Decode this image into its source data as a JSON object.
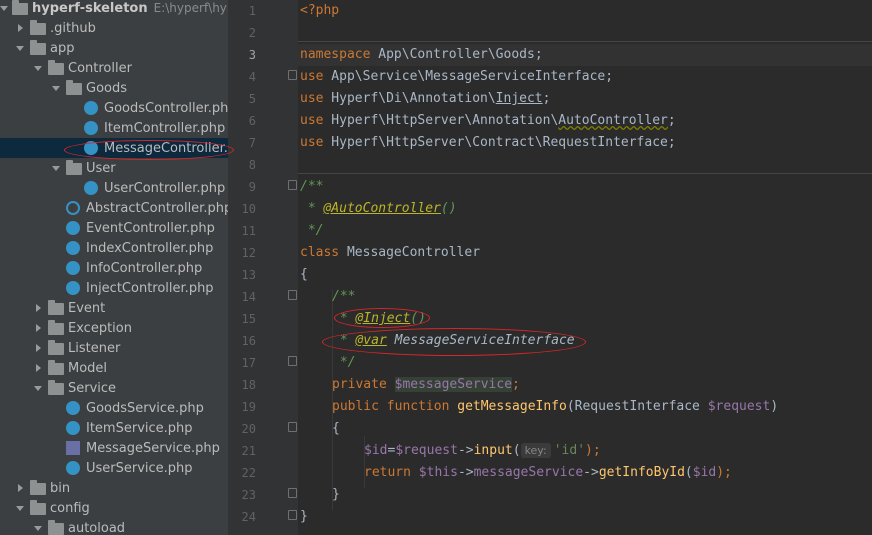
{
  "tree": {
    "root": {
      "label": "hyperf-skeleton",
      "path": "E:\\hyperf\\hyperf-s"
    },
    "items": [
      {
        "label": ".github",
        "kind": "folder",
        "arrow": "right",
        "indent": 0
      },
      {
        "label": "app",
        "kind": "folder",
        "arrow": "down",
        "indent": 0
      },
      {
        "label": "Controller",
        "kind": "folder",
        "arrow": "down",
        "indent": 1
      },
      {
        "label": "Goods",
        "kind": "folder",
        "arrow": "down",
        "indent": 2
      },
      {
        "label": "GoodsController.php",
        "kind": "class",
        "indent": 3
      },
      {
        "label": "ItemController.php",
        "kind": "class",
        "indent": 3
      },
      {
        "label": "MessageController.php",
        "kind": "class",
        "indent": 3,
        "selected": true
      },
      {
        "label": "User",
        "kind": "folder",
        "arrow": "down",
        "indent": 2
      },
      {
        "label": "UserController.php",
        "kind": "class",
        "indent": 3
      },
      {
        "label": "AbstractController.php",
        "kind": "abstract",
        "indent": 2
      },
      {
        "label": "EventController.php",
        "kind": "class",
        "indent": 2
      },
      {
        "label": "IndexController.php",
        "kind": "class",
        "indent": 2
      },
      {
        "label": "InfoController.php",
        "kind": "class",
        "indent": 2
      },
      {
        "label": "InjectController.php",
        "kind": "class",
        "indent": 2
      },
      {
        "label": "Event",
        "kind": "folder",
        "arrow": "right",
        "indent": 1
      },
      {
        "label": "Exception",
        "kind": "folder",
        "arrow": "right",
        "indent": 1
      },
      {
        "label": "Listener",
        "kind": "folder",
        "arrow": "right",
        "indent": 1
      },
      {
        "label": "Model",
        "kind": "folder",
        "arrow": "right",
        "indent": 1
      },
      {
        "label": "Service",
        "kind": "folder",
        "arrow": "down",
        "indent": 1
      },
      {
        "label": "GoodsService.php",
        "kind": "class",
        "indent": 2
      },
      {
        "label": "ItemService.php",
        "kind": "class",
        "indent": 2
      },
      {
        "label": "MessageService.php",
        "kind": "php",
        "indent": 2
      },
      {
        "label": "UserService.php",
        "kind": "class",
        "indent": 2
      },
      {
        "label": "bin",
        "kind": "folder",
        "arrow": "right",
        "indent": 0
      },
      {
        "label": "config",
        "kind": "folder",
        "arrow": "down",
        "indent": 0
      },
      {
        "label": "autoload",
        "kind": "folder",
        "arrow": "down",
        "indent": 1
      }
    ]
  },
  "editor": {
    "current_line": 3,
    "line_numbers": [
      "1",
      "2",
      "3",
      "4",
      "5",
      "6",
      "7",
      "8",
      "9",
      "10",
      "11",
      "12",
      "13",
      "14",
      "15",
      "16",
      "17",
      "18",
      "19",
      "20",
      "21",
      "22",
      "23",
      "24"
    ],
    "code": {
      "l1": "<?php",
      "l3_kw": "namespace",
      "l3_ns": " App\\Controller\\Goods;",
      "use": "use",
      "l4": " App\\Service\\MessageServiceInterface;",
      "l5_a": " Hyperf\\Di\\Annotation\\",
      "l5_b": "Inject",
      "l5_c": ";",
      "l6_a": " Hyperf\\HttpServer\\Annotation\\",
      "l6_b": "AutoController",
      "l6_c": ";",
      "l7": " Hyperf\\HttpServer\\Contract\\RequestInterface;",
      "l9": "/**",
      "l10_a": " * ",
      "l10_b": "@AutoController",
      "l10_c": "()",
      "l11": " */",
      "l12_kw": "class",
      "l12_name": " MessageController",
      "l13": "{",
      "l14": "/**",
      "l15_a": " * ",
      "l15_b": "@Inject",
      "l15_c": "()",
      "l16_a": " * ",
      "l16_b": "@var",
      "l16_c": " MessageServiceInterface",
      "l17": " */",
      "l18_kw": "private",
      "l18_var": "$messageService",
      "l18_end": ";",
      "l19_kw1": "public",
      "l19_kw2": "function",
      "l19_fn": "getMessageInfo",
      "l19_a": "(RequestInterface ",
      "l19_var": "$request",
      "l19_b": ")",
      "l20": "{",
      "l21_v1": "$id",
      "l21_eq": "=",
      "l21_v2": "$request",
      "l21_arrow": "->",
      "l21_fn": "input",
      "l21_paren": "(",
      "l21_hint": "key:",
      "l21_str": "'id'",
      "l21_end": ");",
      "l22_kw": "return",
      "l22_this": "$this",
      "l22_arrow": "->",
      "l22_prop": "messageService",
      "l22_arrow2": "->",
      "l22_fn": "getInfoById",
      "l22_a": "(",
      "l22_var": "$id",
      "l22_b": ");",
      "l23": "}",
      "l24": "}"
    }
  },
  "colors": {
    "keyword": "#cc7832",
    "comment": "#629755",
    "annotation": "#bbb529",
    "variable": "#9876aa",
    "function": "#ffc66d",
    "string": "#6a8759",
    "annotation_circle": "#d9262a"
  }
}
